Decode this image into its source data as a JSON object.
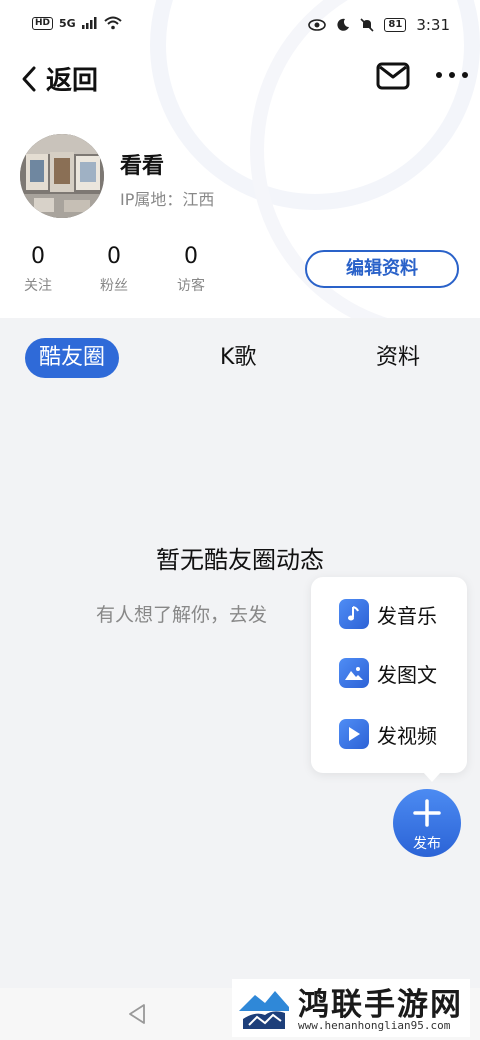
{
  "status_bar": {
    "network": "HD",
    "signal": "5G",
    "battery": "81",
    "time": "3:31"
  },
  "header": {
    "back_label": "返回",
    "icons": [
      "chevron-left-icon",
      "mail-icon",
      "more-icon"
    ]
  },
  "profile": {
    "name": "看看",
    "location": "IP属地：江西",
    "stats": [
      {
        "value": "0",
        "label": "关注"
      },
      {
        "value": "0",
        "label": "粉丝"
      },
      {
        "value": "0",
        "label": "访客"
      }
    ],
    "edit_button": "编辑资料"
  },
  "tabs": [
    {
      "label": "酷友圈",
      "active": true
    },
    {
      "label": "K歌",
      "active": false
    },
    {
      "label": "资料",
      "active": false
    }
  ],
  "empty_state": {
    "title": "暂无酷友圈动态",
    "subtitle": "有人想了解你，去发"
  },
  "publish_menu": {
    "items": [
      {
        "label": "发音乐",
        "icon": "music-note-icon"
      },
      {
        "label": "发图文",
        "icon": "image-icon"
      },
      {
        "label": "发视频",
        "icon": "play-icon"
      }
    ],
    "fab_label": "发布"
  },
  "watermark": {
    "title": "鸿联手游网",
    "url": "www.henanhonglian95.com"
  },
  "colors": {
    "accent": "#2f6ad8",
    "background": "#f2f3f5"
  }
}
